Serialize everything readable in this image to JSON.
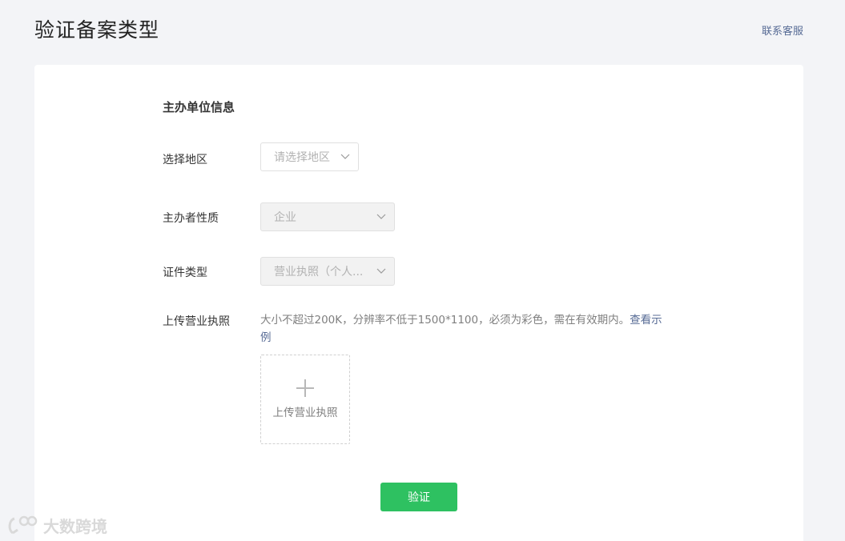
{
  "header": {
    "title": "验证备案类型",
    "contact_link": "联系客服"
  },
  "form": {
    "section_title": "主办单位信息",
    "region": {
      "label": "选择地区",
      "placeholder": "请选择地区"
    },
    "organizer_type": {
      "label": "主办者性质",
      "value": "企业"
    },
    "cert_type": {
      "label": "证件类型",
      "value": "营业执照（个人..."
    },
    "license_upload": {
      "label": "上传营业执照",
      "hint": "大小不超过200K，分辨率不低于1500*1100，必须为彩色，需在有效期内。",
      "example_link": "查看示例",
      "upload_text": "上传营业执照"
    },
    "submit_label": "验证"
  },
  "watermark": {
    "text": "大数跨境"
  },
  "colors": {
    "background": "#f3f4f7",
    "link": "#576b95",
    "primary_button": "#2ec161"
  }
}
